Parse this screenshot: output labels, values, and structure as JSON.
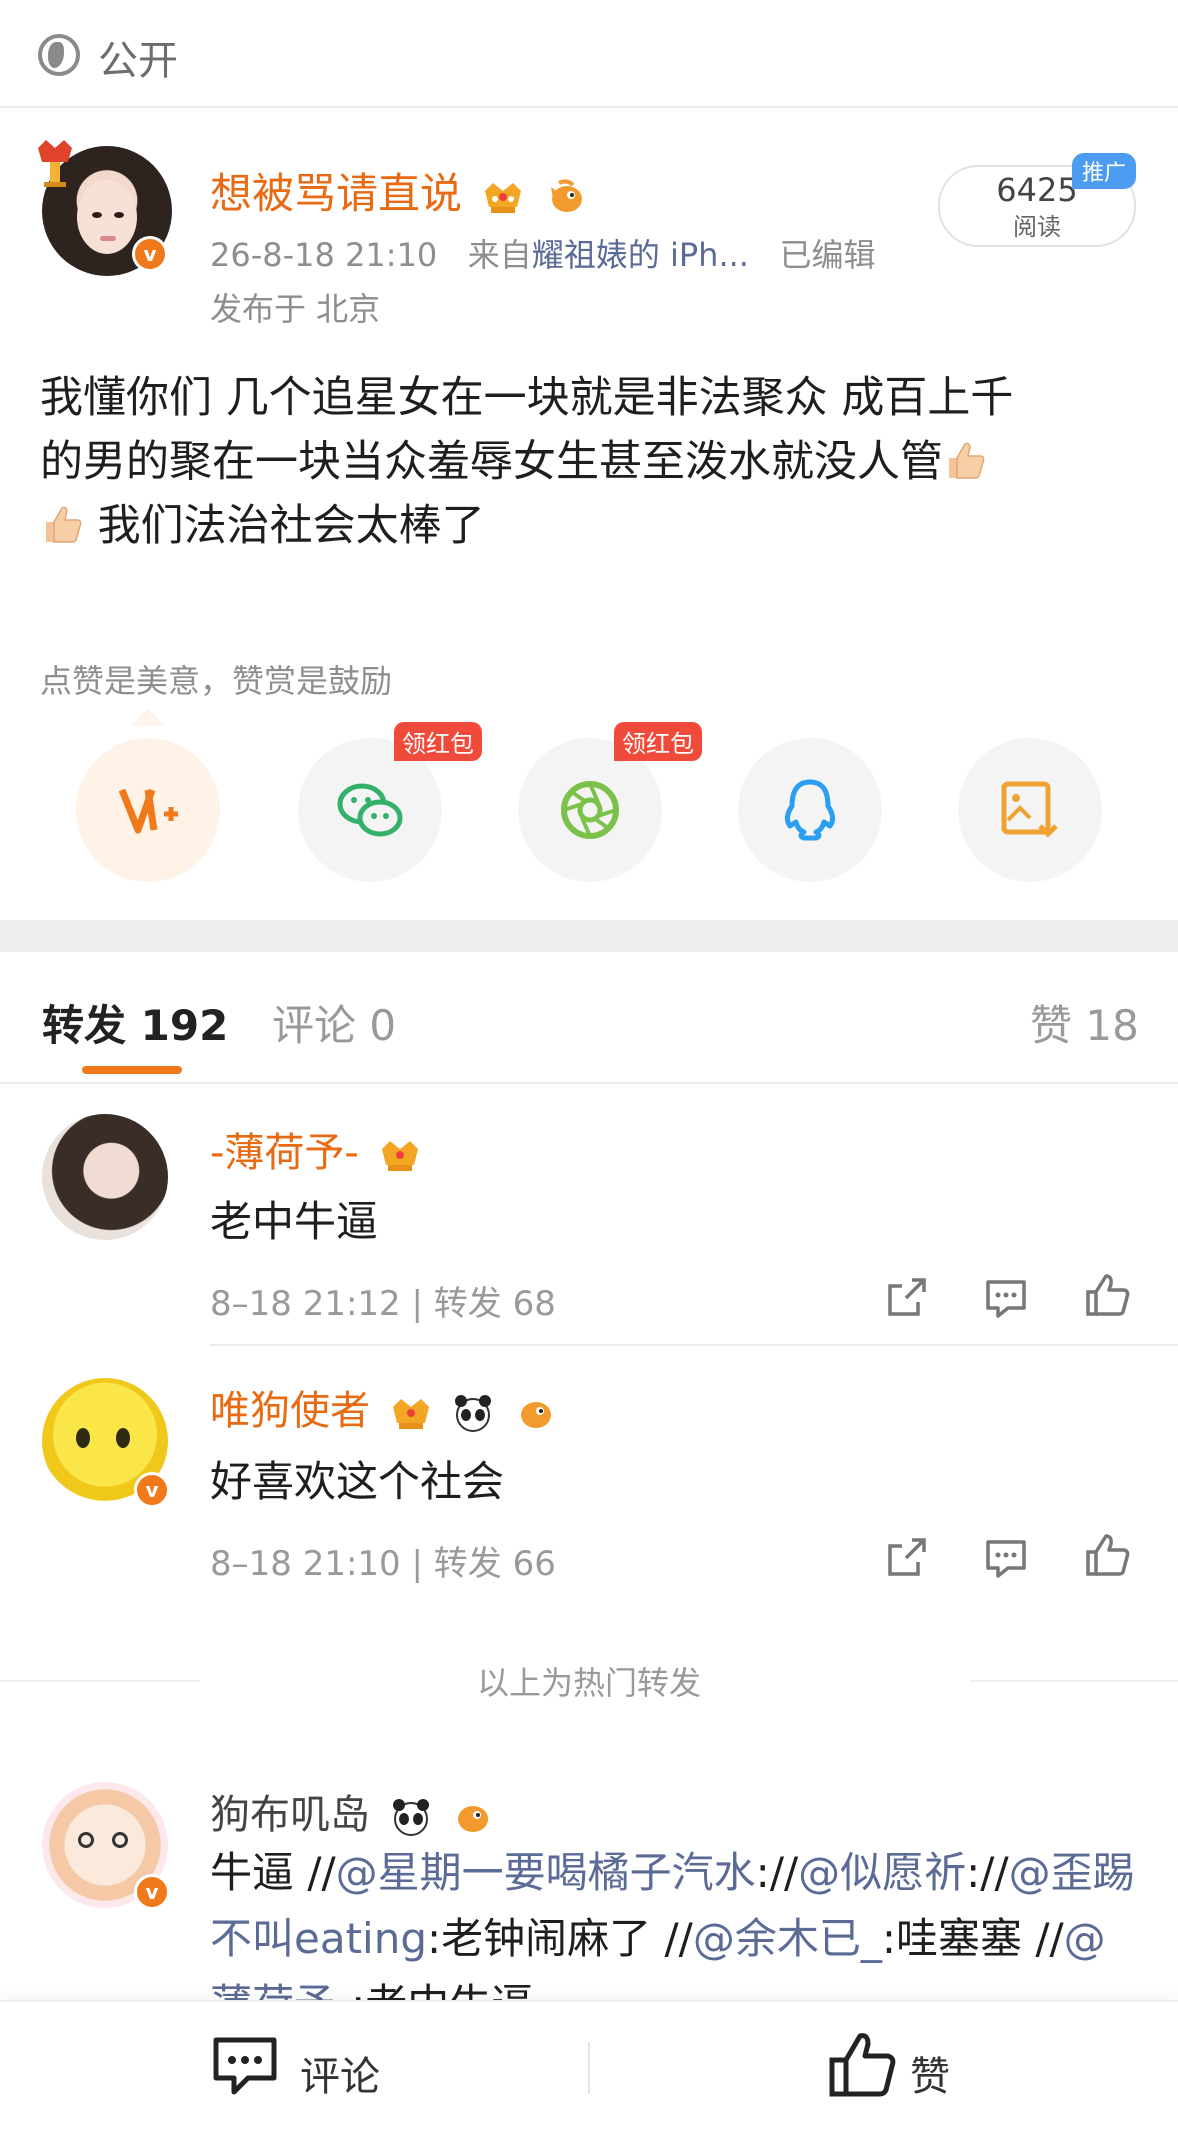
{
  "top_bar": {
    "visibility_label": "公开",
    "icon": "globe-icon"
  },
  "post": {
    "author": "想被骂请直说",
    "time": "26-8-18 21:10",
    "source_prefix": "来自",
    "source": "耀祖婊的 iPh...",
    "edited": "已编辑",
    "location": "发布于 北京",
    "reads_count": "6425",
    "reads_label": "阅读",
    "promo_label": "推广",
    "text_line1": "我懂你们 几个追星女在一块就是非法聚众 成百上千",
    "text_line2": "的男的聚在一块当众羞辱女生甚至泼水就没人管",
    "text_line3": "我们法治社会太棒了"
  },
  "reward": {
    "tip": "点赞是美意，赞赏是鼓励",
    "redpack_label_1": "领红包",
    "redpack_label_2": "领红包",
    "icons": [
      "reward-icon",
      "wechat-icon",
      "moments-icon",
      "qq-icon",
      "save-image-icon"
    ]
  },
  "tabs": {
    "repost_label": "转发",
    "repost_count": "192",
    "comment_label": "评论",
    "comment_count": "0",
    "like_label": "赞",
    "like_count": "18"
  },
  "reposts": [
    {
      "name": "-薄荷予-",
      "text": "老中牛逼",
      "time": "8–18 21:12",
      "repost_info": "转发 68"
    },
    {
      "name": "唯狗使者",
      "text": "好喜欢这个社会",
      "time": "8–18 21:10",
      "repost_info": "转发 66"
    }
  ],
  "hot_separator": "以上为热门转发",
  "latest_repost": {
    "name": "狗布叽岛",
    "p1": "牛逼 //",
    "m1": "@星期一要喝橘子汽水",
    "p2": "://",
    "m2": "@似愿祈",
    "p3": "://",
    "m3": "@歪踢不叫eating",
    "p4": ":老钟闹麻了 //",
    "m4": "@余木已_",
    "p5": ":哇塞塞 //",
    "m5": "@薄荷予-",
    "p6": ":老中牛逼"
  },
  "bottom_bar": {
    "comment_label": "评论",
    "like_label": "赞"
  },
  "colors": {
    "accent_orange": "#f07a1b",
    "name_orange": "#e86a13",
    "mention_blue": "#5b6b96",
    "redpack_red": "#f04b3a",
    "promo_blue": "#4c9cf2"
  }
}
